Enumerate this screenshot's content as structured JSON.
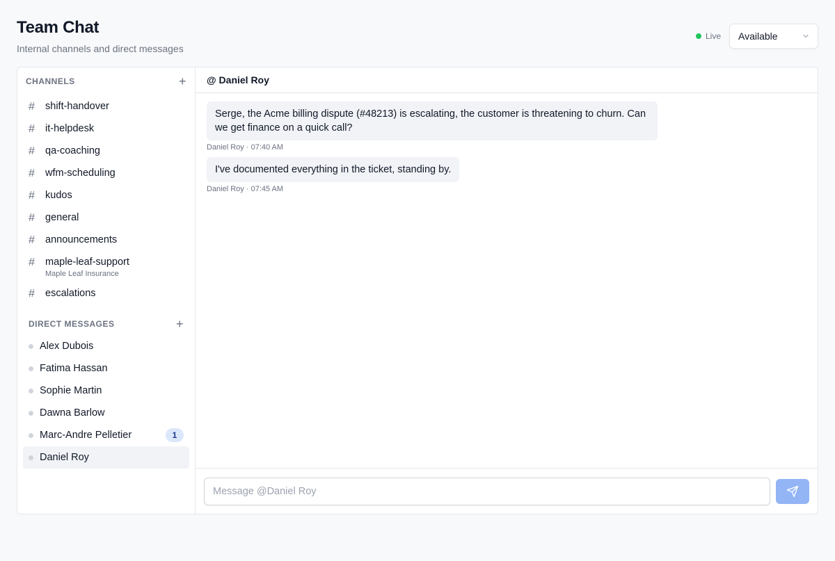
{
  "app": {
    "title": "Team Chat",
    "subtitle": "Internal channels and direct messages"
  },
  "status": {
    "live_label": "Live",
    "selected": "Available"
  },
  "sidebar": {
    "channels_heading": "CHANNELS",
    "dms_heading": "DIRECT MESSAGES",
    "channels": [
      {
        "name": "shift-handover"
      },
      {
        "name": "it-helpdesk"
      },
      {
        "name": "qa-coaching"
      },
      {
        "name": "wfm-scheduling"
      },
      {
        "name": "kudos"
      },
      {
        "name": "general"
      },
      {
        "name": "announcements"
      },
      {
        "name": "maple-leaf-support",
        "subtitle": "Maple Leaf Insurance"
      },
      {
        "name": "escalations"
      }
    ],
    "dms": [
      {
        "name": "Alex Dubois"
      },
      {
        "name": "Fatima Hassan"
      },
      {
        "name": "Sophie Martin"
      },
      {
        "name": "Dawna Barlow"
      },
      {
        "name": "Marc-Andre Pelletier",
        "unread": "1"
      },
      {
        "name": "Daniel Roy",
        "active": true
      }
    ]
  },
  "conversation": {
    "header": "@ Daniel Roy",
    "messages": [
      {
        "text": "Serge, the Acme billing dispute (#48213) is escalating, the customer is threatening to churn. Can we get finance on a quick call?",
        "meta": "Daniel Roy · 07:40 AM"
      },
      {
        "text": "I've documented everything in the ticket, standing by.",
        "meta": "Daniel Roy · 07:45 AM"
      }
    ],
    "composer_placeholder": "Message @Daniel Roy"
  },
  "colors": {
    "live": "#22c55e",
    "send_button": "#93b4f5",
    "badge_bg": "#dbe7fb"
  }
}
